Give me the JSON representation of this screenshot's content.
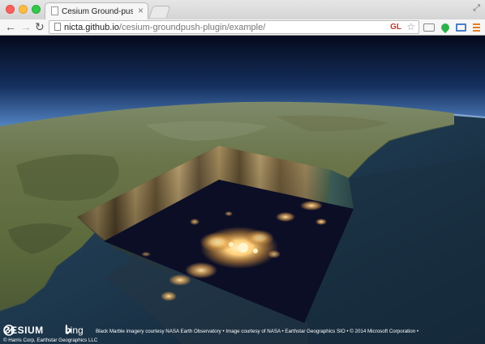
{
  "browser": {
    "tab_title": "Cesium Ground-push Dem",
    "url_host": "nicta.github.io",
    "url_path": "/cesium-groundpush-plugin/example/",
    "gl_badge": "GL"
  },
  "credits": {
    "cesium_label": "CESIUM",
    "bing_label": "bing",
    "line1": "Black Marble imagery courtesy NASA Earth Observatory • Image courtesy of NASA • Earthstar Geographics SIO • © 2014 Microsoft Corporation •",
    "line2": "© Harris Corp, Earthstar Geographics LLC"
  },
  "colors": {
    "sky_top": "#0a1530",
    "horizon": "#6b9fd6",
    "land": "#5e6b43",
    "ocean": "#1f3448",
    "night_panel": "#0d1028",
    "city_lights": "#ffd48a"
  }
}
